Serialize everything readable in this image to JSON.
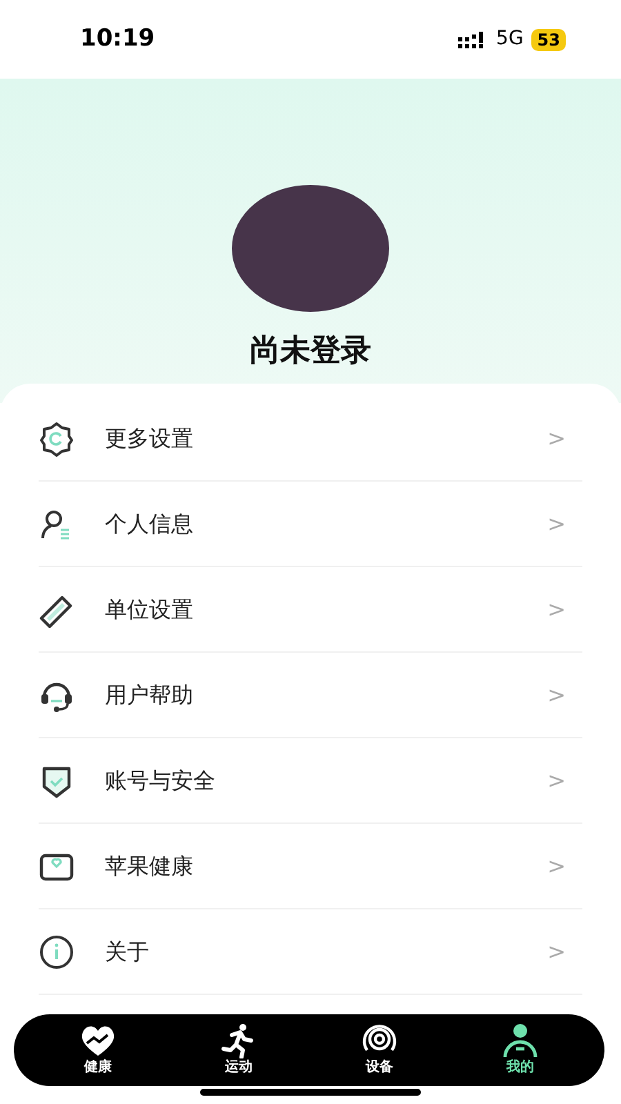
{
  "status_bar": {
    "time": "10:19",
    "network": "5G",
    "battery": "53"
  },
  "profile": {
    "name": "尚未登录"
  },
  "menu": [
    {
      "label": "更多设置",
      "chevron": ">"
    },
    {
      "label": "个人信息",
      "chevron": ">"
    },
    {
      "label": "单位设置",
      "chevron": ">"
    },
    {
      "label": "用户帮助",
      "chevron": ">"
    },
    {
      "label": "账号与安全",
      "chevron": ">"
    },
    {
      "label": "苹果健康",
      "chevron": ">"
    },
    {
      "label": "关于",
      "chevron": ">"
    }
  ],
  "tabs": [
    {
      "label": "健康",
      "selected": false
    },
    {
      "label": "运动",
      "selected": false
    },
    {
      "label": "设备",
      "selected": false
    },
    {
      "label": "我的",
      "selected": true
    }
  ]
}
